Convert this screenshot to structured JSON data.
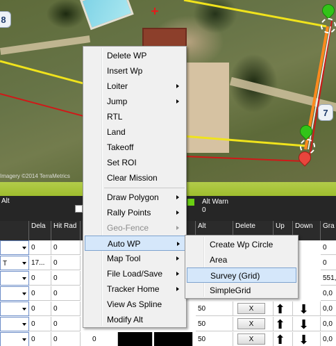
{
  "map": {
    "waypoint_labels": [
      "8",
      "7"
    ],
    "imagery_credit": "Imagery ©2014 TerraMetrics"
  },
  "status_strip": {
    "alt_label": "Alt",
    "alt_warn_label": "Alt Warn",
    "alt_warn_value": "0"
  },
  "grid": {
    "headers": [
      "Dela",
      "Hit Rad",
      "Alt",
      "Delete",
      "Up",
      "Down",
      "Gra"
    ],
    "rows": [
      {
        "type": "",
        "c1": "0",
        "c2": "0",
        "alt": "",
        "grad": "0"
      },
      {
        "type": "T",
        "c1": "17...",
        "c2": "0",
        "alt": "",
        "grad": "0"
      },
      {
        "type": "",
        "c1": "0",
        "c2": "0",
        "alt": "",
        "grad": "551,"
      },
      {
        "type": "",
        "c1": "0",
        "c2": "0",
        "alt": "",
        "grad": "0,0"
      },
      {
        "type": "",
        "c1": "0",
        "c2": "0",
        "alt": "50",
        "delete": "X",
        "grad": "0,0"
      },
      {
        "type": "",
        "c1": "0",
        "c2": "0",
        "alt": "50",
        "delete": "X",
        "grad": "0,0"
      },
      {
        "type": "",
        "c1": "0",
        "c2": "0",
        "c3": "0",
        "alt": "50",
        "delete": "X",
        "grad": "0,0"
      }
    ]
  },
  "context_menu": {
    "items": [
      {
        "label": "Delete WP",
        "submenu": false
      },
      {
        "label": "Insert Wp",
        "submenu": false
      },
      {
        "label": "Loiter",
        "submenu": true
      },
      {
        "label": "Jump",
        "submenu": true
      },
      {
        "label": "RTL",
        "submenu": false
      },
      {
        "label": "Land",
        "submenu": false
      },
      {
        "label": "Takeoff",
        "submenu": false
      },
      {
        "label": "Set ROI",
        "submenu": false
      },
      {
        "label": "Clear Mission",
        "submenu": false
      },
      {
        "label": "Draw Polygon",
        "submenu": true
      },
      {
        "label": "Rally Points",
        "submenu": true
      },
      {
        "label": "Geo-Fence",
        "submenu": true,
        "disabled": true
      },
      {
        "label": "Auto WP",
        "submenu": true,
        "highlighted": true
      },
      {
        "label": "Map Tool",
        "submenu": true
      },
      {
        "label": "File Load/Save",
        "submenu": true
      },
      {
        "label": "Tracker Home",
        "submenu": true
      },
      {
        "label": "View As Spline",
        "submenu": false
      },
      {
        "label": "Modify Alt",
        "submenu": false
      }
    ]
  },
  "auto_wp_submenu": {
    "items": [
      {
        "label": "Create Wp Circle"
      },
      {
        "label": "Area"
      },
      {
        "label": "Survey (Grid)",
        "highlighted": true
      },
      {
        "label": "SimpleGrid"
      }
    ]
  },
  "colors": {
    "menu_background": "#f0f0f0",
    "menu_highlight": "#d5e7fa",
    "menu_highlight_border": "#7da2ce",
    "mission_line": "#f0e31c",
    "fence_line": "#d01818",
    "strip_green": "#a5c236"
  }
}
